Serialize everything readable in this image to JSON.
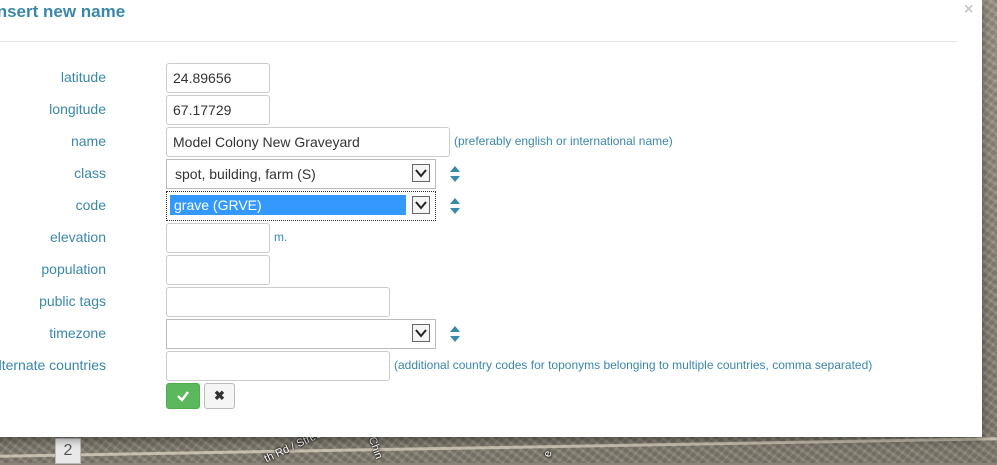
{
  "modal": {
    "title": "Insert new name",
    "close_symbol": "×"
  },
  "fields": {
    "latitude": {
      "label": "latitude",
      "value": "24.89656"
    },
    "longitude": {
      "label": "longitude",
      "value": "67.17729"
    },
    "name": {
      "label": "name",
      "value": "Model Colony New Graveyard",
      "hint": "(preferably english or international name)"
    },
    "class": {
      "label": "class",
      "value": "spot, building, farm (S)"
    },
    "code": {
      "label": "code",
      "value": "grave (GRVE)"
    },
    "elevation": {
      "label": "elevation",
      "value": "",
      "unit": "m."
    },
    "population": {
      "label": "population",
      "value": ""
    },
    "public_tags": {
      "label": "public tags",
      "value": ""
    },
    "timezone": {
      "label": "timezone",
      "value": ""
    },
    "alternate_countries": {
      "label": "alternate countries",
      "value": "",
      "hint": "(additional country codes for toponyms belonging to multiple countries, comma separated)"
    }
  },
  "buttons": {
    "ok_icon": "check-icon",
    "cancel_symbol": "✖"
  },
  "map": {
    "badge": "2",
    "street_label": "th Rd / Street",
    "label_b": "Chin",
    "label_c": "e"
  },
  "colors": {
    "label": "#3a87ad",
    "ok_button": "#5cb85c",
    "selection": "#3399ff"
  }
}
